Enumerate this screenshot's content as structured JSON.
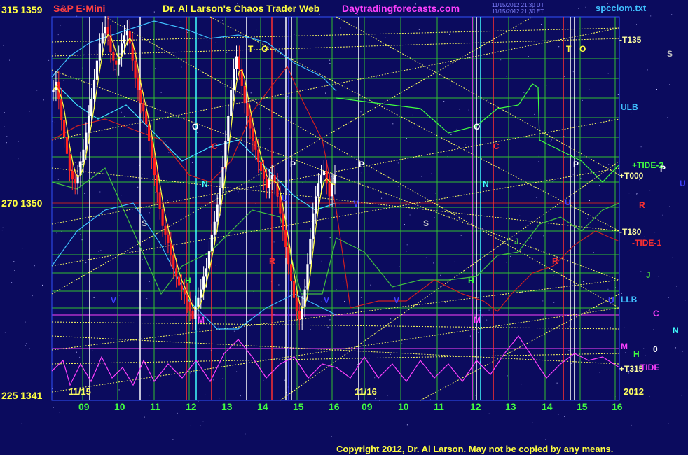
{
  "header": {
    "symbol": "S&P E-Mini",
    "title": "Dr. Al Larson's Chaos Trader Web",
    "site": "Daytradingforecasts.com",
    "timestamp1": "11/15/2012 21:30 UT",
    "timestamp2": "11/15/2012 21:30 ET",
    "file": "spcclom.txt",
    "colors": {
      "symbol": "#ff4040",
      "title": "#ffff40",
      "site": "#ff40ff",
      "file": "#40c0ff"
    }
  },
  "left_axis": [
    {
      "label": "315  1359",
      "value": 1359
    },
    {
      "label": "270  1350",
      "value": 1350
    },
    {
      "label": "225  1341",
      "value": 1341
    }
  ],
  "x_axis": {
    "start_dates": [
      "11/15",
      "11/16"
    ],
    "year": "2012",
    "hours": [
      "09",
      "10",
      "11",
      "12",
      "13",
      "14",
      "15",
      "16",
      "09",
      "10",
      "11",
      "12",
      "13",
      "14",
      "15",
      "16"
    ]
  },
  "right_labels": [
    {
      "text": "-T135",
      "color": "#ffffa0"
    },
    {
      "text": "S",
      "color": "#c0c0c0"
    },
    {
      "text": "ULB",
      "color": "#40c0ff"
    },
    {
      "text": "+TIDE-2",
      "color": "#40ff40"
    },
    {
      "text": "P",
      "color": "#ffffff"
    },
    {
      "text": "+T000",
      "color": "#ffffa0"
    },
    {
      "text": "U",
      "color": "#4040ff"
    },
    {
      "text": "R",
      "color": "#ff3030"
    },
    {
      "text": "-T180",
      "color": "#ffffa0"
    },
    {
      "text": "-TIDE-1",
      "color": "#ff3030"
    },
    {
      "text": "J",
      "color": "#40c040"
    },
    {
      "text": "LLB",
      "color": "#40c0ff"
    },
    {
      "text": "C",
      "color": "#ff40ff"
    },
    {
      "text": "N",
      "color": "#40ffff"
    },
    {
      "text": "M",
      "color": "#ff40ff"
    },
    {
      "text": "0",
      "color": "#ffffff"
    },
    {
      "text": "H",
      "color": "#40ff40"
    },
    {
      "text": "+T315",
      "color": "#ffffa0"
    },
    {
      "text": "TIDE",
      "color": "#ff40ff"
    }
  ],
  "planet_markers": [
    {
      "text": "T",
      "color": "#ffff40"
    },
    {
      "text": "O",
      "color": "#ffff40"
    },
    {
      "text": "T",
      "color": "#ffff40"
    },
    {
      "text": "O",
      "color": "#ffff40"
    },
    {
      "text": "O",
      "color": "#ffffff"
    },
    {
      "text": "O",
      "color": "#ffffff"
    },
    {
      "text": "C",
      "color": "#ff3030"
    },
    {
      "text": "C",
      "color": "#ff3030"
    },
    {
      "text": "P",
      "color": "#ffffff"
    },
    {
      "text": "P",
      "color": "#ffffff"
    },
    {
      "text": "P",
      "color": "#ffffff"
    },
    {
      "text": "P",
      "color": "#ffffff"
    },
    {
      "text": "N",
      "color": "#40ffff"
    },
    {
      "text": "N",
      "color": "#40ffff"
    },
    {
      "text": "S",
      "color": "#c0c0c0"
    },
    {
      "text": "S",
      "color": "#c0c0c0"
    },
    {
      "text": "R",
      "color": "#ff3030"
    },
    {
      "text": "R",
      "color": "#ff3030"
    },
    {
      "text": "U",
      "color": "#4040ff"
    },
    {
      "text": "U",
      "color": "#4040ff"
    },
    {
      "text": "H",
      "color": "#40ff40"
    },
    {
      "text": "H",
      "color": "#40ff40"
    },
    {
      "text": "J",
      "color": "#40c040"
    },
    {
      "text": "M",
      "color": "#ff40ff"
    },
    {
      "text": "M",
      "color": "#ff40ff"
    },
    {
      "text": "V",
      "color": "#4040ff"
    },
    {
      "text": "V",
      "color": "#4040ff"
    },
    {
      "text": "V",
      "color": "#4040ff"
    },
    {
      "text": "V",
      "color": "#4040ff"
    },
    {
      "text": "U",
      "color": "#4040ff"
    }
  ],
  "copyright": "Copyright 2012, Dr. Al Larson. May not be copied by any means.",
  "chart_data": {
    "type": "candlestick",
    "title": "S&P E-Mini",
    "y_range": [
      1341,
      1359
    ],
    "x_unit": "hour",
    "bar_interval_minutes": 5,
    "closes": [
      1355.4,
      1355.8,
      1355.0,
      1354.0,
      1353.2,
      1352.4,
      1351.6,
      1351.2,
      1351.0,
      1351.4,
      1352.0,
      1352.6,
      1353.4,
      1354.2,
      1355.0,
      1355.9,
      1356.8,
      1357.6,
      1358.1,
      1358.4,
      1358.0,
      1357.2,
      1356.8,
      1356.6,
      1357.0,
      1357.6,
      1358.0,
      1358.2,
      1357.6,
      1356.8,
      1356.0,
      1355.4,
      1354.8,
      1354.4,
      1353.8,
      1353.0,
      1352.2,
      1351.4,
      1350.6,
      1349.8,
      1349.0,
      1348.6,
      1348.2,
      1347.6,
      1347.0,
      1346.6,
      1346.2,
      1346.0,
      1345.8,
      1345.4,
      1345.0,
      1344.6,
      1345.2,
      1345.6,
      1346.0,
      1346.6,
      1347.0,
      1347.8,
      1348.6,
      1349.2,
      1350.0,
      1350.8,
      1351.8,
      1353.0,
      1354.2,
      1355.4,
      1356.4,
      1357.0,
      1356.4,
      1355.6,
      1354.8,
      1354.2,
      1353.6,
      1353.0,
      1352.6,
      1352.0,
      1351.6,
      1351.2,
      1350.8,
      1351.2,
      1351.4,
      1351.0,
      1350.4,
      1349.6,
      1348.8,
      1348.0,
      1347.2,
      1346.4,
      1345.6,
      1345.0,
      1344.6,
      1345.2,
      1346.0,
      1347.2,
      1348.4,
      1349.6,
      1350.4,
      1351.0,
      1351.4,
      1351.6,
      1351.0,
      1350.4,
      1351.0,
      1351.4
    ]
  }
}
